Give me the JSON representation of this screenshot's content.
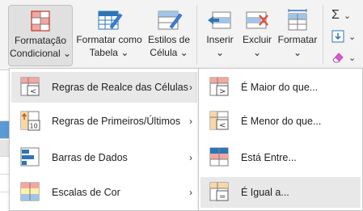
{
  "ribbon": {
    "cond_format": {
      "line1": "Formatação",
      "line2": "Condicional",
      "caret": "⌄"
    },
    "format_table": {
      "line1": "Formatar como",
      "line2": "Tabela",
      "caret": "⌄"
    },
    "cell_styles": {
      "line1": "Estilos de",
      "line2": "Célula",
      "caret": "⌄"
    },
    "insert": {
      "line1": "Inserir",
      "caret": "⌄"
    },
    "delete": {
      "line1": "Excluir",
      "caret": "⌄"
    },
    "format": {
      "line1": "Formatar",
      "caret": "⌄"
    },
    "sum_symbol": "Σ",
    "sum_caret": "⌄",
    "fill_caret": "⌄",
    "clear_caret": "⌄"
  },
  "menu": {
    "items": [
      {
        "label": "Regras de Realce das Células",
        "arrow": "›"
      },
      {
        "label": "Regras de Primeiros/Últimos",
        "arrow": "›"
      },
      {
        "label": "Barras de Dados",
        "arrow": "›"
      },
      {
        "label": "Escalas de Cor",
        "arrow": "›"
      }
    ],
    "first_rules_icon_number": "10"
  },
  "submenu": {
    "items": [
      {
        "label": "É Maior do que..."
      },
      {
        "label": "É Menor do que..."
      },
      {
        "label": "Está Entre..."
      },
      {
        "label": "É Igual a..."
      }
    ]
  },
  "colors": {
    "ribbon_bg": "#f3f3f3",
    "highlight": "#e8e8e8",
    "accent_blue": "#2e75b6",
    "accent_red": "#e74c3c"
  }
}
